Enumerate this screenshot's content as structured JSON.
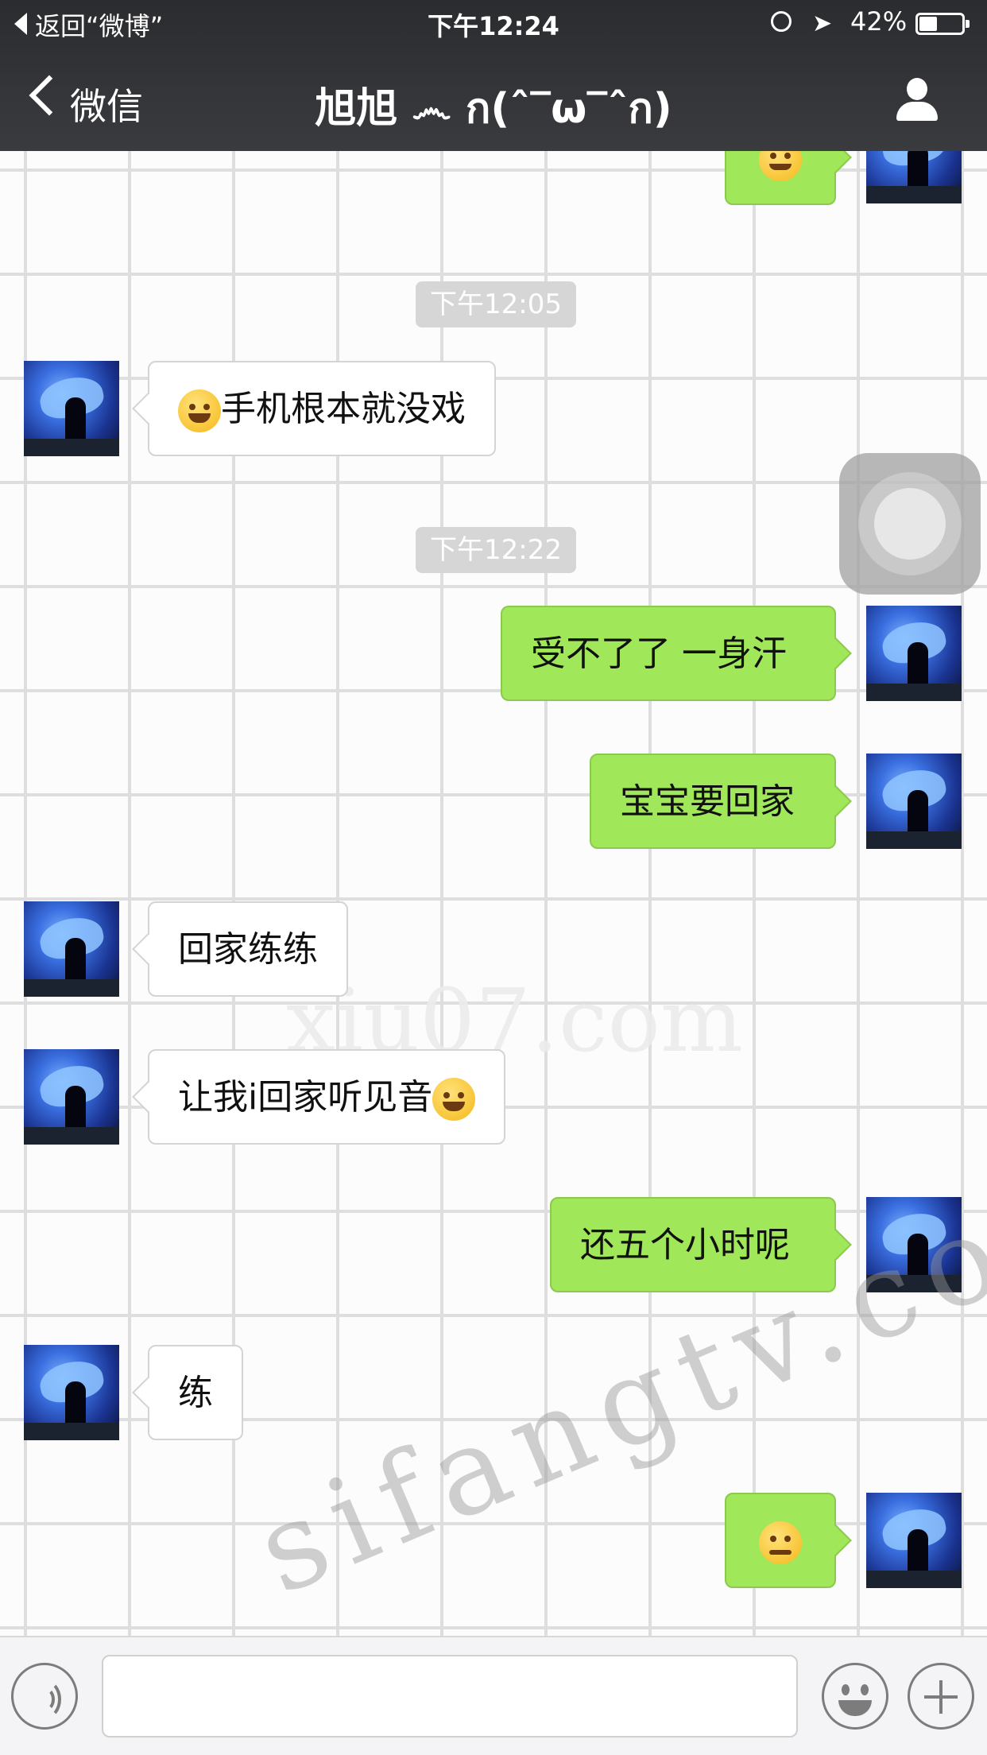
{
  "status_bar": {
    "back_app": "返回“微博”",
    "time": "下午12:24",
    "battery": "42%",
    "battery_level": 0.42
  },
  "nav": {
    "back_label": "微信",
    "title": "旭旭 ෴ ก(ˆ‾ω‾ˆก)"
  },
  "messages": [
    {
      "side": "right",
      "type": "emoji",
      "emoji": "smile-emoji"
    },
    {
      "type": "timestamp",
      "text": "下午12:05"
    },
    {
      "side": "left",
      "text": "手机根本就没戏",
      "emoji_before": "tears-of-joy-emoji"
    },
    {
      "type": "timestamp",
      "text": "下午12:22"
    },
    {
      "side": "right",
      "text": "受不了了 一身汗"
    },
    {
      "side": "right",
      "text": "宝宝要回家"
    },
    {
      "side": "left",
      "text": "回家练练"
    },
    {
      "side": "left",
      "text": "让我i回家听见音",
      "emoji_after": "tears-of-joy-emoji"
    },
    {
      "side": "right",
      "text": "还五个小时呢"
    },
    {
      "side": "left",
      "text": "练"
    },
    {
      "side": "right",
      "type": "emoji",
      "emoji": "persevering-emoji"
    }
  ],
  "watermarks": [
    "xiu07.com",
    "sifangtv.com"
  ],
  "input_bar": {
    "voice_icon": "voice-icon",
    "emoji_icon": "emoji-icon",
    "plus_icon": "plus-icon"
  }
}
